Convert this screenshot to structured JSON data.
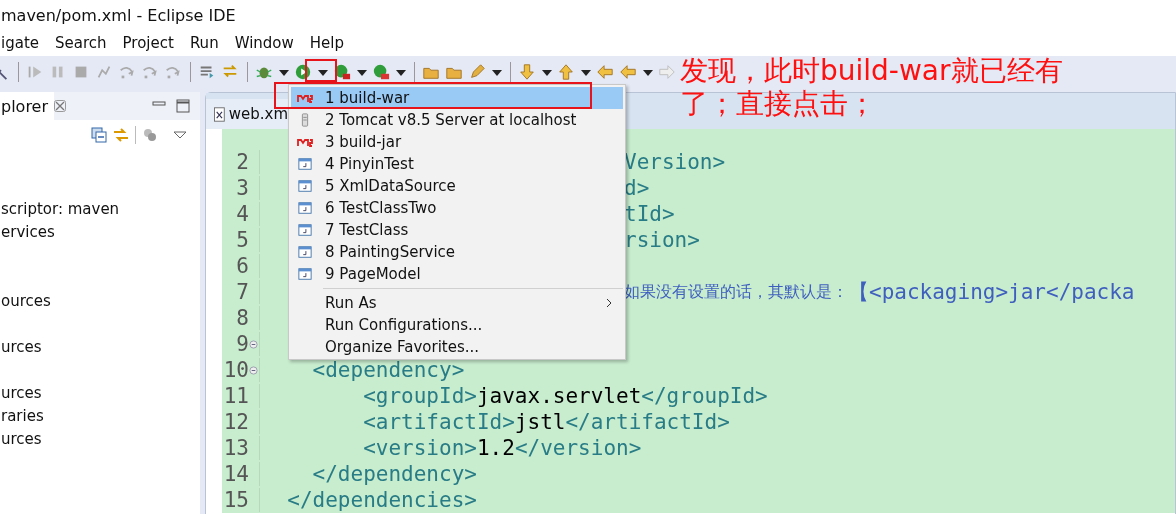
{
  "window": {
    "title": "maven/pom.xml - Eclipse IDE"
  },
  "menu_bar": [
    "igate",
    "Search",
    "Project",
    "Run",
    "Window",
    "Help"
  ],
  "explorer": {
    "tab": "plorer",
    "items": [
      "scriptor: maven",
      "ervices",
      "ources",
      "urces",
      "urces",
      "raries",
      "urces"
    ]
  },
  "editor": {
    "tab": "web.xm",
    "lines": [
      {
        "number": "2",
        "fold": false,
        "after_menu": [
          {
            "kind": "tag",
            "text": "Version>"
          }
        ]
      },
      {
        "number": "3",
        "fold": false,
        "after_menu": [
          {
            "kind": "tag",
            "text": "d>"
          }
        ]
      },
      {
        "number": "4",
        "fold": false,
        "after_menu": [
          {
            "kind": "tag",
            "text": "tId>"
          }
        ]
      },
      {
        "number": "5",
        "fold": false,
        "after_menu": [
          {
            "kind": "tag",
            "text": "rsion>"
          }
        ]
      },
      {
        "number": "6",
        "fold": false
      },
      {
        "number": "7",
        "fold": false,
        "after_menu": [
          {
            "kind": "comment-cjk",
            "text": "如果没有设置的话，其默认是："
          },
          {
            "kind": "comment",
            "text": "【<packaging>jar</packa"
          }
        ]
      },
      {
        "number": "8",
        "fold": false
      },
      {
        "number": "9",
        "fold": true
      },
      {
        "number": "10",
        "fold": true,
        "code": [
          {
            "kind": "tag",
            "text": "<dependency>"
          }
        ]
      },
      {
        "number": "11",
        "fold": false,
        "code": [
          {
            "kind": "tag",
            "text": "<groupId>"
          },
          {
            "kind": "plain",
            "text": "javax.servlet"
          },
          {
            "kind": "tag",
            "text": "</groupId>"
          }
        ]
      },
      {
        "number": "12",
        "fold": false,
        "code": [
          {
            "kind": "tag",
            "text": "<artifactId>"
          },
          {
            "kind": "plain",
            "text": "jstl"
          },
          {
            "kind": "tag",
            "text": "</artifactId>"
          }
        ]
      },
      {
        "number": "13",
        "fold": false,
        "code": [
          {
            "kind": "tag",
            "text": "<version>"
          },
          {
            "kind": "plain",
            "text": "1.2"
          },
          {
            "kind": "tag",
            "text": "</version>"
          }
        ]
      },
      {
        "number": "14",
        "fold": false,
        "code": [
          {
            "kind": "tag",
            "text": "</dependency>"
          }
        ]
      },
      {
        "number": "15",
        "fold": false,
        "code": [
          {
            "kind": "tag",
            "text": "</dependencies>"
          }
        ]
      }
    ]
  },
  "run_menu": {
    "items": [
      {
        "kind": "maven",
        "label": "1 build-war",
        "selected": true
      },
      {
        "kind": "server",
        "label": "2 Tomcat v8.5 Server at localhost",
        "selected": false
      },
      {
        "kind": "maven",
        "label": "3 build-jar",
        "selected": false
      },
      {
        "kind": "java",
        "label": "4 PinyinTest",
        "selected": false
      },
      {
        "kind": "java",
        "label": "5 XmlDataSource",
        "selected": false
      },
      {
        "kind": "java",
        "label": "6 TestClassTwo",
        "selected": false
      },
      {
        "kind": "java",
        "label": "7 TestClass",
        "selected": false
      },
      {
        "kind": "java",
        "label": "8 PaintingService",
        "selected": false
      },
      {
        "kind": "java",
        "label": "9 PageModel",
        "selected": false
      },
      {
        "kind": "separator"
      },
      {
        "kind": "submenu",
        "label": "Run As",
        "selected": false
      },
      {
        "kind": "command",
        "label": "Run Configurations...",
        "selected": false
      },
      {
        "kind": "command",
        "label": "Organize Favorites...",
        "selected": false
      }
    ]
  },
  "annotation": {
    "lines": [
      "发现，此时build-war就已经有",
      "了；直接点击；"
    ]
  }
}
